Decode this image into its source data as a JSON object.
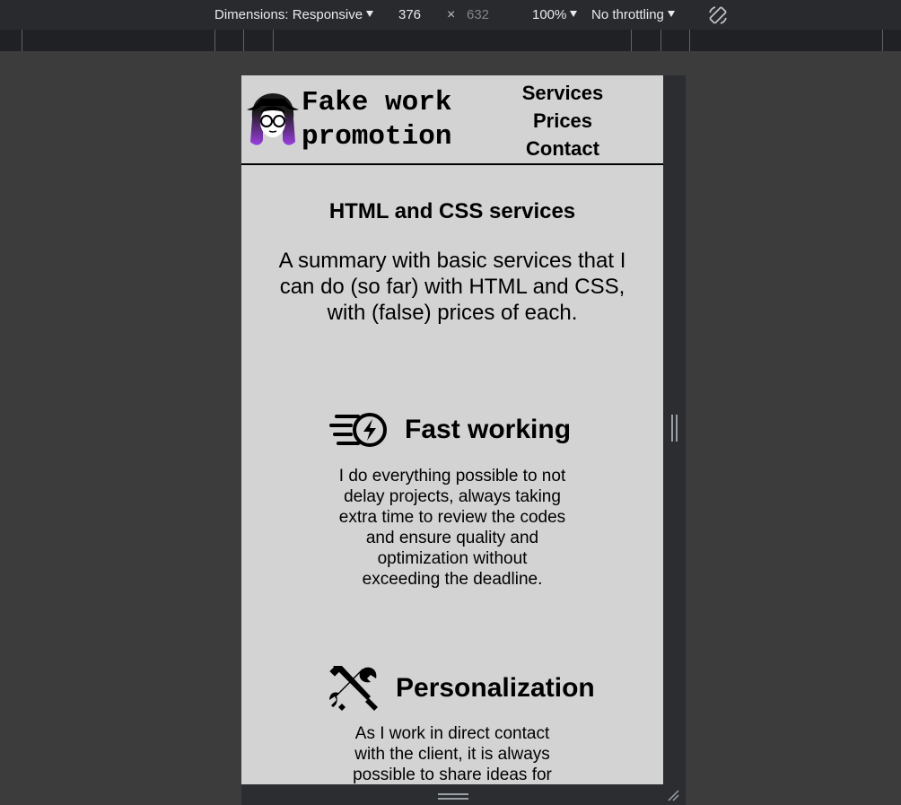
{
  "devtools": {
    "dimensions_label": "Dimensions: Responsive",
    "width_value": "376",
    "times_symbol": "×",
    "height_value": "632",
    "zoom_label": "100%",
    "throttling_label": "No throttling",
    "rotate_icon": "rotate-icon"
  },
  "page": {
    "brand": "Fake work promotion",
    "nav": [
      "Services",
      "Prices",
      "Contact"
    ],
    "section_title": "HTML and CSS services",
    "summary": "A summary with basic services that I can do (so far) with HTML and CSS, with (false) prices of each.",
    "features": [
      {
        "icon": "speed-bolt-icon",
        "title": "Fast working",
        "text": "I do everything possible to not delay projects, always taking extra time to review the codes and ensure quality and optimization without exceeding the deadline."
      },
      {
        "icon": "tools-icon",
        "title": "Personalization",
        "text": "As I work in direct contact with the client, it is always possible to share ideas for"
      }
    ]
  },
  "colors": {
    "page_background": "#d3d3d3",
    "devtools_background": "#3c3c3c",
    "avatar_hair": "#000000",
    "avatar_gradient_top": "#ffffff",
    "avatar_gradient_bottom": "#8a2be2"
  }
}
